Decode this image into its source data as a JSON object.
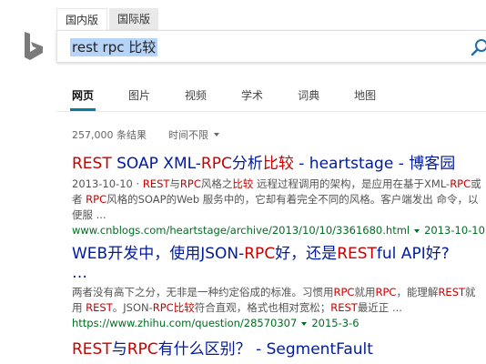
{
  "region_tabs": [
    {
      "label": "国内版",
      "active": true
    },
    {
      "label": "国际版",
      "active": false
    }
  ],
  "search": {
    "value": "rest rpc 比较"
  },
  "nav": [
    {
      "label": "网页",
      "active": true
    },
    {
      "label": "图片",
      "active": false
    },
    {
      "label": "视频",
      "active": false
    },
    {
      "label": "学术",
      "active": false
    },
    {
      "label": "词典",
      "active": false
    },
    {
      "label": "地图",
      "active": false
    }
  ],
  "stats": {
    "count": "257,000 条结果",
    "time_filter": "时间不限"
  },
  "results": [
    {
      "title_parts": [
        "REST",
        " SOAP XML-",
        "RPC",
        "分析",
        "比较",
        " - heartstage - 博客园"
      ],
      "snippet_parts": [
        "2013-10-10 · ",
        "REST",
        "与",
        "RPC",
        "风格之",
        "比较",
        " 远程过程调用的架构，是应用在基于XML-",
        "RPC",
        "或者 ",
        "RPC",
        "风格的SOAP的Web 服务中的，它却有着完全不同的风格。客户端发出 命令，以便服 ..."
      ],
      "url": "www.cnblogs.com/heartstage/archive/2013/10/10/3361680.html",
      "date": "2013-10-10"
    },
    {
      "title_parts": [
        "WEB开发中，使用JSON-",
        "RPC",
        "好，还是",
        "REST",
        "ful API好?"
      ],
      "title_line2": "…",
      "snippet_parts": [
        "两者没有高下之分，无非是一种约定俗成的标准。习惯用",
        "RPC",
        "就用",
        "RPC",
        "，能理解",
        "REST",
        "就用 ",
        "REST",
        "。JSON-",
        "RPC",
        "比较",
        "符合直观，格式也相对宽松；",
        "REST",
        "最近正 ..."
      ],
      "url": "https://www.zhihu.com/question/28570307",
      "date": "2015-3-6"
    },
    {
      "title_parts": [
        "REST",
        "与",
        "RPC",
        "有什么区别？ - SegmentFault"
      ]
    }
  ],
  "colors": {
    "accent": "#00809d",
    "link": "#001ba0",
    "highlight": "#c80000",
    "url": "#006d21"
  }
}
